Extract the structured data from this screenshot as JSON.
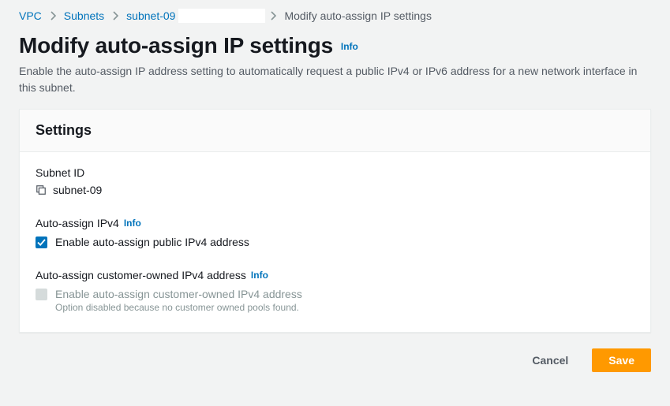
{
  "breadcrumb": {
    "items": [
      "VPC",
      "Subnets",
      "subnet-09"
    ],
    "current": "Modify auto-assign IP settings"
  },
  "header": {
    "title": "Modify auto-assign IP settings",
    "info": "Info",
    "description": "Enable the auto-assign IP address setting to automatically request a public IPv4 or IPv6 address for a new network interface in this subnet."
  },
  "panel": {
    "title": "Settings",
    "subnet_id_label": "Subnet ID",
    "subnet_id_value": "subnet-09",
    "ipv4": {
      "heading": "Auto-assign IPv4",
      "info": "Info",
      "checkbox_label": "Enable auto-assign public IPv4 address",
      "checked": true
    },
    "customer": {
      "heading": "Auto-assign customer-owned IPv4 address",
      "info": "Info",
      "checkbox_label": "Enable auto-assign customer-owned IPv4 address",
      "helper": "Option disabled because no customer owned pools found."
    }
  },
  "actions": {
    "cancel": "Cancel",
    "save": "Save"
  }
}
